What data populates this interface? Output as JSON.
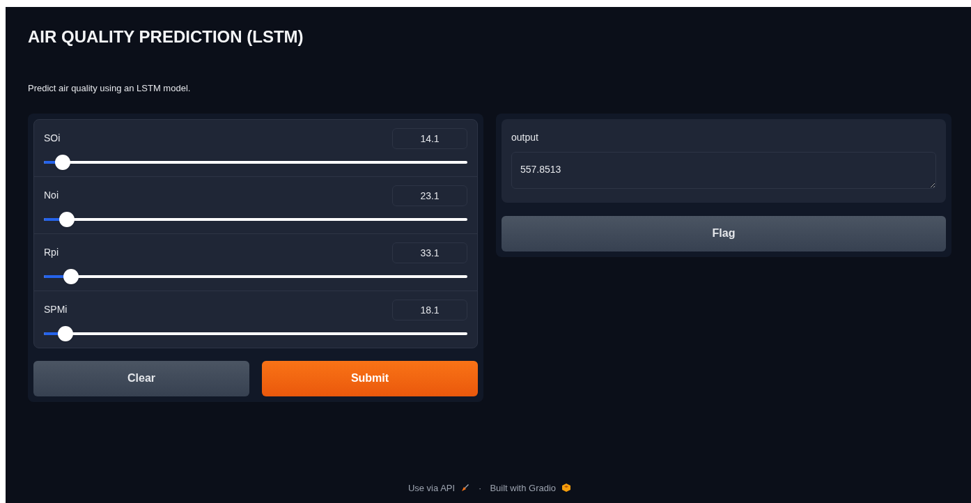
{
  "title": "AIR QUALITY PREDICTION (LSTM)",
  "description": "Predict air quality using an LSTM model.",
  "sliders": [
    {
      "label": "SOi",
      "value": "14.1",
      "level": 0.03
    },
    {
      "label": "Noi",
      "value": "23.1",
      "level": 0.04
    },
    {
      "label": "Rpi",
      "value": "33.1",
      "level": 0.05
    },
    {
      "label": "SPMi",
      "value": "18.1",
      "level": 0.036
    }
  ],
  "buttons": [
    {
      "label": "Clear",
      "kind": "secondary"
    },
    {
      "label": "Submit",
      "kind": "primary"
    }
  ],
  "output": {
    "label": "output",
    "value": "557.8513"
  },
  "flag_button": "Flag",
  "footer": {
    "api_link": "Use via API",
    "separator": "·",
    "built_with": "Built with Gradio"
  }
}
